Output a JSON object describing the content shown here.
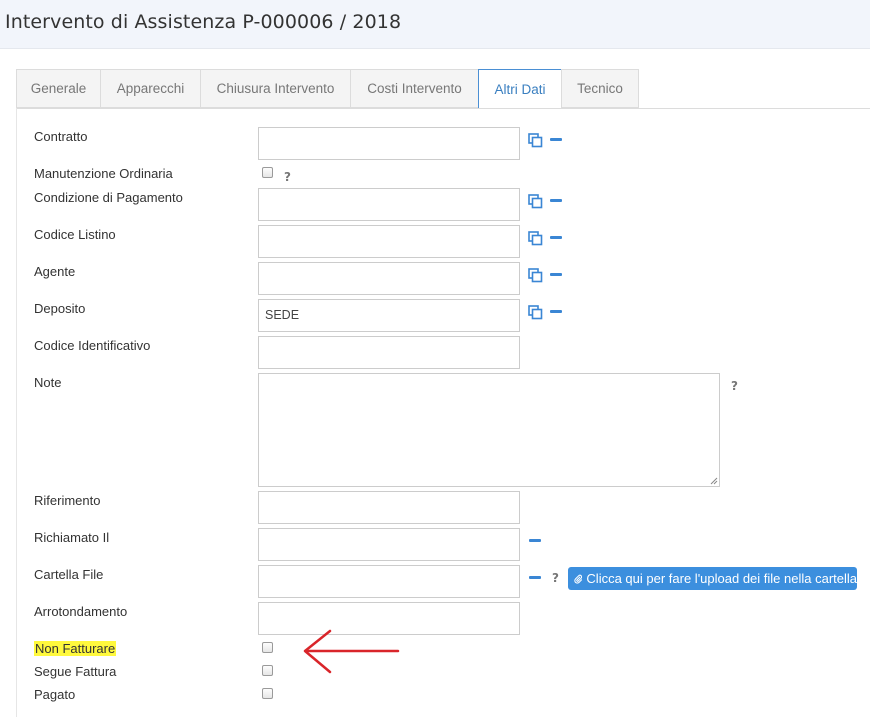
{
  "header": {
    "title": "Intervento di Assistenza P-000006 / 2018"
  },
  "tabs": [
    {
      "label": "Generale",
      "active": false
    },
    {
      "label": "Apparecchi",
      "active": false
    },
    {
      "label": "Chiusura Intervento",
      "active": false
    },
    {
      "label": "Costi Intervento",
      "active": false
    },
    {
      "label": "Altri Dati",
      "active": true
    },
    {
      "label": "Tecnico",
      "active": false
    }
  ],
  "form": {
    "contratto": {
      "label": "Contratto",
      "value": ""
    },
    "manutenzione_ordinaria": {
      "label": "Manutenzione Ordinaria",
      "checked": false,
      "help": "?"
    },
    "condizione_pagamento": {
      "label": "Condizione di Pagamento",
      "value": ""
    },
    "codice_listino": {
      "label": "Codice Listino",
      "value": ""
    },
    "agente": {
      "label": "Agente",
      "value": ""
    },
    "deposito": {
      "label": "Deposito",
      "value": "SEDE"
    },
    "codice_identificativo": {
      "label": "Codice Identificativo",
      "value": ""
    },
    "note": {
      "label": "Note",
      "value": "",
      "help": "?"
    },
    "riferimento": {
      "label": "Riferimento",
      "value": ""
    },
    "richiamato_il": {
      "label": "Richiamato Il",
      "value": ""
    },
    "cartella_file": {
      "label": "Cartella File",
      "value": "",
      "help": "?",
      "upload_label": "Clicca qui per fare l'upload dei file nella cartella"
    },
    "arrotondamento": {
      "label": "Arrotondamento",
      "value": ""
    },
    "non_fatturare": {
      "label": "Non Fatturare",
      "checked": false
    },
    "segue_fattura": {
      "label": "Segue Fattura",
      "checked": false
    },
    "pagato": {
      "label": "Pagato",
      "checked": false
    }
  },
  "colors": {
    "accent": "#3c8fde",
    "highlight": "#fff93d",
    "arrow": "#d9252a"
  }
}
